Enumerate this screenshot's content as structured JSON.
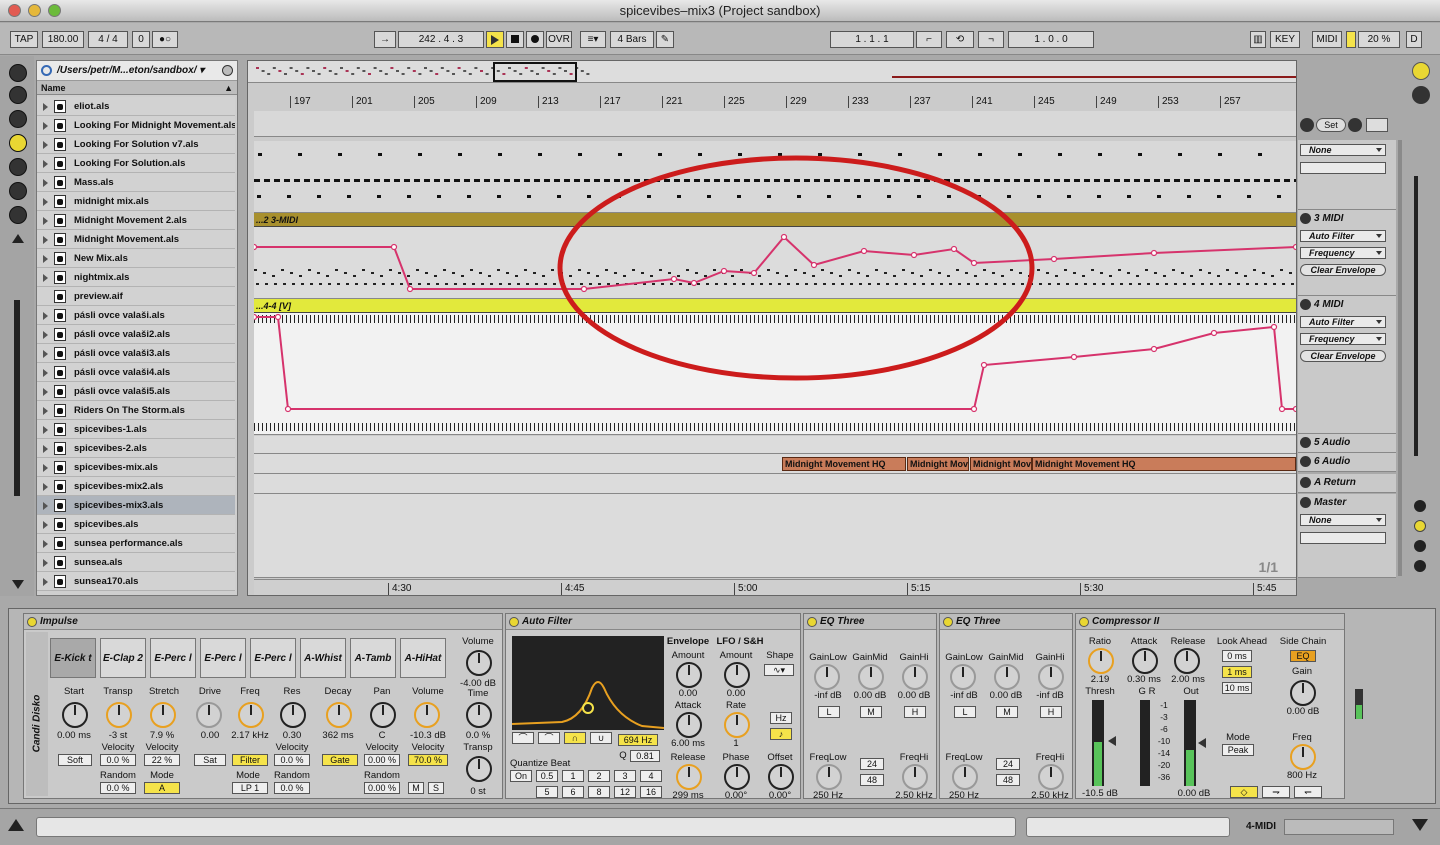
{
  "window": {
    "title": "spicevibes–mix3 (Project sandbox)"
  },
  "control_bar": {
    "tap": "TAP",
    "tempo": "180.00",
    "sig_num": "4",
    "sig_sep": "/",
    "sig_den": "4",
    "groove": "0",
    "metro": "●○",
    "follow": "→",
    "position": "242 .   4 .   3",
    "ovr": "OVR",
    "quant": "4 Bars",
    "loop_start": "1 .   1 .   1",
    "loop_len": "1 .   0 .   0",
    "key": "KEY",
    "midi": "MIDI",
    "cpu": "20 %",
    "disk": "D"
  },
  "browser": {
    "path": "/Users/petr/M...eton/sandbox/",
    "column": "Name",
    "files": [
      "eliot.als",
      "Looking For Midnight Movement.als",
      "Looking For Solution v7.als",
      "Looking For Solution.als",
      "Mass.als",
      "midnight mix.als",
      "Midnight Movement 2.als",
      "Midnight Movement.als",
      "New Mix.als",
      "nightmix.als",
      "preview.aif",
      "pásli ovce valaši.als",
      "pásli ovce valaši2.als",
      "pásli ovce valaši3.als",
      "pásli ovce valaši4.als",
      "pásli ovce valaši5.als",
      "Riders On The Storm.als",
      "spicevibes-1.als",
      "spicevibes-2.als",
      "spicevibes-mix.als",
      "spicevibes-mix2.als",
      "spicevibes-mix3.als",
      "spicevibes.als",
      "sunsea performance.als",
      "sunsea.als",
      "sunsea170.als"
    ],
    "selected": "spicevibes-mix3.als"
  },
  "arrangement": {
    "bars": [
      "197",
      "201",
      "205",
      "209",
      "213",
      "217",
      "221",
      "225",
      "229",
      "233",
      "237",
      "241",
      "245",
      "249",
      "253",
      "257"
    ],
    "times": [
      "4:30",
      "4:45",
      "5:00",
      "5:15",
      "5:30",
      "5:45"
    ],
    "clip3": "...2 3-MIDI",
    "clip4": "...4-4 [V]",
    "audio_clips": [
      "Midnight Movement HQ",
      "Midnight Mov",
      "Midnight Mov",
      "Midnight Movement HQ"
    ],
    "page": "1/1"
  },
  "track_panel": {
    "set": "Set",
    "none1": "None",
    "t3": "3 MIDI",
    "t3_device": "Auto Filter",
    "t3_param": "Frequency",
    "t3_clear": "Clear Envelope",
    "t4": "4 MIDI",
    "t4_device": "Auto Filter",
    "t4_param": "Frequency",
    "t4_clear": "Clear Envelope",
    "t5": "5 Audio",
    "t6": "6 Audio",
    "ret": "A Return",
    "master": "Master",
    "none2": "None"
  },
  "impulse": {
    "title": "Impulse",
    "side": "Candi Disko",
    "pads": [
      "E-Kick t",
      "E-Clap 2",
      "E-Perc l",
      "E-Perc l",
      "E-Perc l",
      "A-Whist",
      "A-Tamb",
      "A-HiHat"
    ],
    "labels": {
      "start": "Start",
      "transp": "Transp",
      "stretch": "Stretch",
      "drive": "Drive",
      "freq": "Freq",
      "res": "Res",
      "decay": "Decay",
      "pan": "Pan",
      "volume": "Volume",
      "volume2": "Volume",
      "time": "Time",
      "transp2": "Transp",
      "vel": "Velocity",
      "random": "Random",
      "mode": "Mode"
    },
    "values": {
      "start": "0.00 ms",
      "transp": "-3 st",
      "stretch": "7.9 %",
      "drive": "0.00",
      "freq": "2.17 kHz",
      "res": "0.30",
      "decay": "362 ms",
      "pan": "C",
      "volume": "-10.3 dB",
      "gvol": "-4.00 dB",
      "time": "0.0 %",
      "transp2": "0 st"
    },
    "boxes": {
      "soft": "Soft",
      "tv": "0.0 %",
      "sv": "22 %",
      "sat": "Sat",
      "filter": "Filter",
      "fv": "0.0 %",
      "gate": "Gate",
      "pv": "0.00 %",
      "vv": "70.0 %",
      "tr": "0.0 %",
      "a": "A",
      "lp": "LP 1",
      "fr": "0.0 %",
      "pr": "0.00 %",
      "m": "M",
      "s": "S"
    }
  },
  "auto_filter": {
    "title": "Auto Filter",
    "freq": "694 Hz",
    "q_label": "Q",
    "q": "0.81",
    "env": "Envelope",
    "amount": "Amount",
    "amount_v": "0.00",
    "attack": "Attack",
    "attack_v": "6.00 ms",
    "release": "Release",
    "release_v": "299 ms",
    "lfo": "LFO / S&H",
    "lamount": "Amount",
    "lamount_v": "0.00",
    "rate": "Rate",
    "rate_v": "1",
    "hz": "Hz",
    "shape": "Shape",
    "phase": "Phase",
    "phase_v": "0.00°",
    "offset": "Offset",
    "offset_v": "0.00°",
    "qb": "Quantize Beat",
    "qb_btns": [
      "On",
      "0.5",
      "1",
      "2",
      "3",
      "4",
      "5",
      "6",
      "8",
      "12",
      "16"
    ]
  },
  "eq1": {
    "title": "EQ Three",
    "gl": "GainLow",
    "gm": "GainMid",
    "gh": "GainHi",
    "gl_v": "-inf dB",
    "gm_v": "0.00 dB",
    "gh_v": "0.00 dB",
    "l": "L",
    "m": "M",
    "h": "H",
    "fl": "FreqLow",
    "fh": "FreqHi",
    "fl_v": "250 Hz",
    "fh_v": "2.50 kHz",
    "s24": "24",
    "s48": "48"
  },
  "eq2": {
    "title": "EQ Three",
    "gl": "GainLow",
    "gm": "GainMid",
    "gh": "GainHi",
    "gl_v": "-inf dB",
    "gm_v": "0.00 dB",
    "gh_v": "-inf dB",
    "l": "L",
    "m": "M",
    "h": "H",
    "fl": "FreqLow",
    "fh": "FreqHi",
    "fl_v": "250 Hz",
    "fh_v": "2.50 kHz",
    "s24": "24",
    "s48": "48"
  },
  "comp": {
    "title": "Compressor II",
    "ratio": "Ratio",
    "ratio_v": "2.19",
    "attack": "Attack",
    "attack_v": "0.30 ms",
    "release": "Release",
    "release_v": "2.00 ms",
    "look": "Look Ahead",
    "la0": "0 ms",
    "la1": "1 ms",
    "la10": "10 ms",
    "side": "Side Chain",
    "eq": "EQ",
    "gain": "Gain",
    "gain_v": "0.00 dB",
    "thresh": "Thresh",
    "thresh_v": "-10.5 dB",
    "gr": "G R",
    "out": "Out",
    "out_v": "0.00 dB",
    "mode": "Mode",
    "mode_v": "Peak",
    "freq": "Freq",
    "freq_v": "800 Hz",
    "scale": [
      "-1",
      "-3",
      "-6",
      "-10",
      "-14",
      "-20",
      "-36"
    ]
  },
  "status": {
    "track": "4-MIDI"
  },
  "colors": {
    "accent": "#f5e34a",
    "envelope": "#d6336c",
    "clip": "#c97c5a",
    "midi_clip": "#a8902e",
    "annotation": "#cc1c1c"
  }
}
